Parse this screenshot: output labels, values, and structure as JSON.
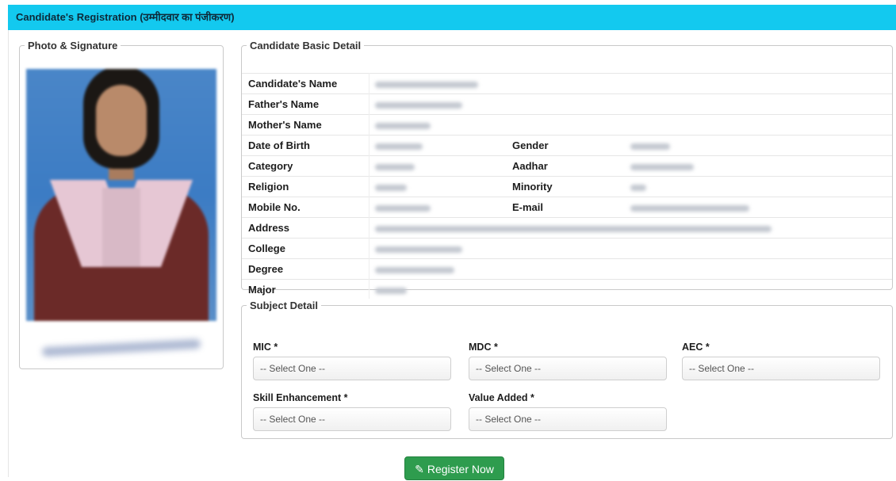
{
  "header": {
    "title": "Candidate's Registration (उम्मीदवार का पंजीकरण)"
  },
  "photo_section": {
    "legend": "Photo & Signature"
  },
  "basic_detail": {
    "legend": "Candidate Basic Detail",
    "labels": {
      "name": "Candidate's Name",
      "father": "Father's Name",
      "mother": "Mother's Name",
      "dob": "Date of Birth",
      "gender": "Gender",
      "category": "Category",
      "aadhar": "Aadhar",
      "religion": "Religion",
      "minority": "Minority",
      "mobile": "Mobile No.",
      "email": "E-mail",
      "address": "Address",
      "college": "College",
      "degree": "Degree",
      "major": "Major"
    }
  },
  "subject_detail": {
    "legend": "Subject Detail",
    "mic": {
      "label": "MIC *",
      "value": "-- Select One --"
    },
    "mdc": {
      "label": "MDC *",
      "value": "-- Select One --"
    },
    "aec": {
      "label": "AEC *",
      "value": "-- Select One --"
    },
    "skill": {
      "label": "Skill Enhancement *",
      "value": "-- Select One --"
    },
    "value_added": {
      "label": "Value Added *",
      "value": "-- Select One --"
    }
  },
  "register_button": {
    "label": "Register Now",
    "icon": "pencil-icon"
  }
}
